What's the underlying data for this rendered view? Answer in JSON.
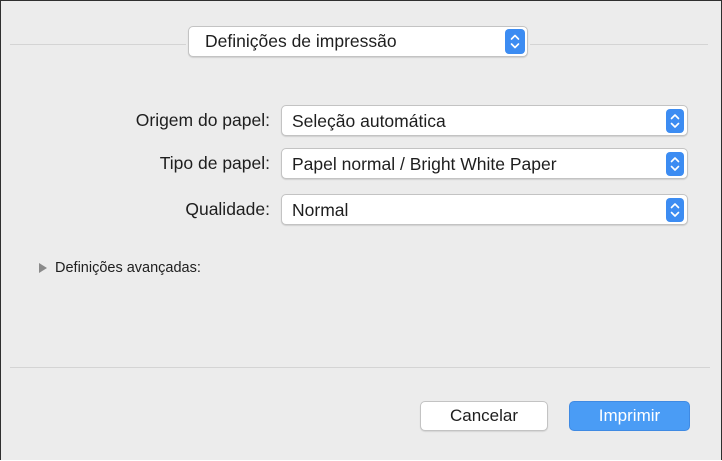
{
  "preset_menu": {
    "value": "Definições de impressão"
  },
  "fields": [
    {
      "label": "Origem do papel:",
      "value": "Seleção automática"
    },
    {
      "label": "Tipo de papel:",
      "value": "Papel normal / Bright White Paper"
    },
    {
      "label": "Qualidade:",
      "value": "Normal"
    }
  ],
  "advanced": {
    "label": "Definições avançadas:"
  },
  "buttons": {
    "cancel": "Cancelar",
    "print": "Imprimir"
  },
  "colors": {
    "accent": "#4a9cf5",
    "background": "#ececec"
  },
  "icons": {
    "stepper": "up-down-chevron-icon",
    "disclosure": "disclosure-triangle-icon"
  }
}
